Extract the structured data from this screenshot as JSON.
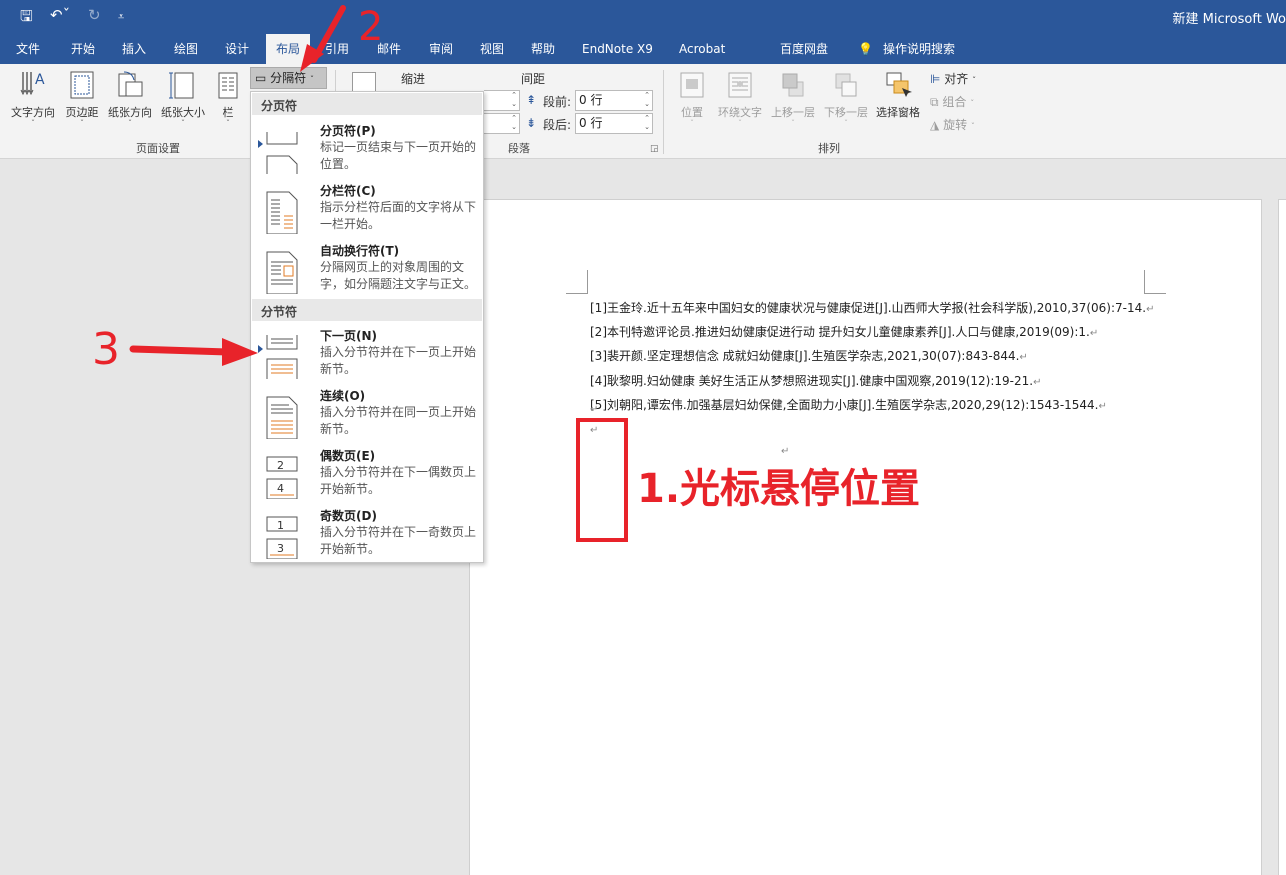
{
  "window": {
    "title": "新建 Microsoft Wo"
  },
  "quick_access": [
    {
      "icon": "save-icon",
      "glyph": "🖫"
    },
    {
      "icon": "undo-icon",
      "glyph": "↶ˇ"
    },
    {
      "icon": "redo-icon",
      "glyph": "↻"
    },
    {
      "icon": "customize-icon",
      "glyph": "⩡"
    }
  ],
  "tabs": [
    "文件",
    "开始",
    "插入",
    "绘图",
    "设计",
    "布局",
    "引用",
    "邮件",
    "审阅",
    "视图",
    "帮助",
    "EndNote X9",
    "Acrobat",
    "百度网盘",
    "操作说明搜索"
  ],
  "active_tab": "布局",
  "ribbon": {
    "page_setup": {
      "label": "页面设置",
      "buttons": [
        "文字方向",
        "页边距",
        "纸张方向",
        "纸张大小",
        "栏"
      ]
    },
    "breaks_label": "分隔符",
    "paragraph": {
      "label": "段落",
      "indent_label": "缩进",
      "spacing_label": "间距",
      "before_label": "段前:",
      "before_value": "0 行",
      "after_label": "段后:",
      "after_value": "0 行"
    },
    "arrange": {
      "label": "排列",
      "buttons": [
        "位置",
        "环绕文字",
        "上移一层",
        "下移一层",
        "选择窗格"
      ],
      "small": [
        "对齐",
        "组合",
        "旋转"
      ]
    }
  },
  "menu": {
    "page_breaks_header": "分页符",
    "section_breaks_header": "分节符",
    "items": [
      {
        "title": "分页符(P)",
        "desc": "标记一页结束与下一页开始的位置。"
      },
      {
        "title": "分栏符(C)",
        "desc": "指示分栏符后面的文字将从下一栏开始。"
      },
      {
        "title": "自动换行符(T)",
        "desc": "分隔网页上的对象周围的文字，如分隔题注文字与正文。"
      },
      {
        "title": "下一页(N)",
        "desc": "插入分节符并在下一页上开始新节。"
      },
      {
        "title": "连续(O)",
        "desc": "插入分节符并在同一页上开始新节。"
      },
      {
        "title": "偶数页(E)",
        "desc": "插入分节符并在下一偶数页上开始新节。"
      },
      {
        "title": "奇数页(D)",
        "desc": "插入分节符并在下一奇数页上开始新节。"
      }
    ]
  },
  "document": {
    "references": [
      "[1]王金玲.近十五年来中国妇女的健康状况与健康促进[J].山西师大学报(社会科学版),2010,37(06):7-14.",
      "[2]本刊特邀评论员.推进妇幼健康促进行动  提升妇女儿童健康素养[J].人口与健康,2019(09):1.",
      "[3]裴开颜.坚定理想信念  成就妇幼健康[J].生殖医学杂志,2021,30(07):843-844.",
      "[4]耿黎明.妇幼健康  美好生活正从梦想照进现实[J].健康中国观察,2019(12):19-21.",
      "[5]刘朝阳,谭宏伟.加强基层妇幼保健,全面助力小康[J].生殖医学杂志,2020,29(12):1543-1544."
    ],
    "paragraph_mark": "↵"
  },
  "annotations": {
    "label1": "1.光标悬停位置",
    "label2": "2",
    "label3": "3",
    "color": "#e8232a"
  }
}
